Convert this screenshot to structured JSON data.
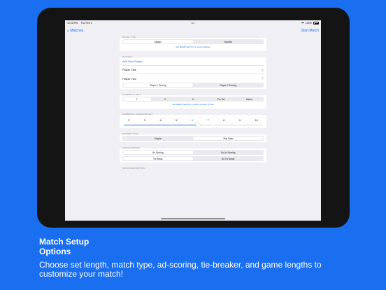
{
  "status": {
    "time": "10:18 PM",
    "date": "Thu Feb 1",
    "battery": "100%"
  },
  "nav": {
    "back_label": "Matches",
    "action_label": "Start Match"
  },
  "match_type": {
    "header": "MATCH TYPE",
    "options": [
      "Singles",
      "Doubles"
    ],
    "selected": 0,
    "promo": "Get MatchTrack Pro to score doubles"
  },
  "players": {
    "header": "PLAYERS",
    "add_label": "Add New Player",
    "player_one": "Player One",
    "player_two": "Player Two",
    "serving": [
      "Player 1 Serving",
      "Player 2 Serving"
    ],
    "serving_selected": 0
  },
  "sets": {
    "header": "NUMBER OF SETS",
    "options": [
      "1",
      "3",
      "5",
      "Pro Set",
      "Match"
    ],
    "selected": 0,
    "promo": "Get MatchTrack Pro to select number of sets"
  },
  "games": {
    "header": "NUMBER OF GAMES PER SET",
    "values": [
      "2",
      "3",
      "4",
      "5",
      "6",
      "7",
      "8",
      "9",
      "10"
    ],
    "selected_value": 6
  },
  "scoring": {
    "header": "SCORING TYPE",
    "options": [
      "Simple",
      "Stat Stats"
    ],
    "selected": 1
  },
  "match_options": {
    "header": "MATCH OPTIONS",
    "ad": [
      "Ad Scoring",
      "No Ad Scoring"
    ],
    "ad_selected": 0,
    "tiebreak": [
      "Tie Break",
      "No Tie Break"
    ],
    "tiebreak_selected": 0
  },
  "description": {
    "header": "MATCH DESCRIPTION"
  },
  "caption": {
    "title_line1": "Match Setup",
    "title_line2": "Options",
    "body": "Choose set length, match type, ad-scoring, tie-breaker, and game lengths to customize your match!"
  },
  "colors": {
    "background": "#1a6ff0",
    "accent": "#1a6ff0",
    "device": "#141414"
  }
}
